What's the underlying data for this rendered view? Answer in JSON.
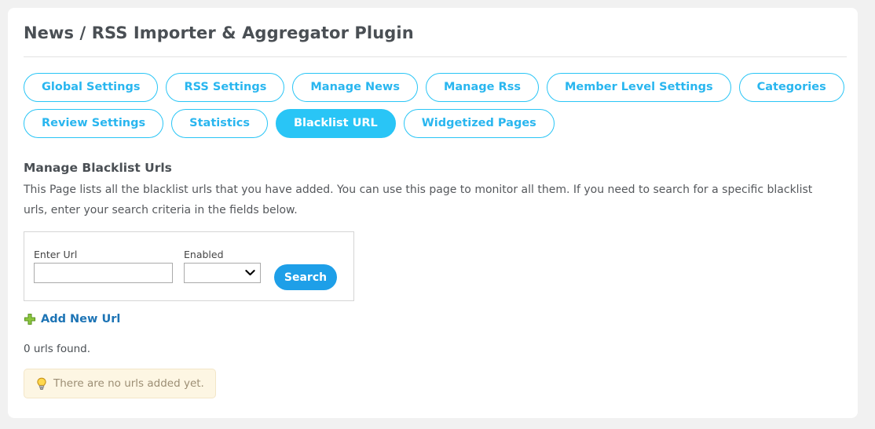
{
  "page": {
    "title": "News / RSS Importer & Aggregator Plugin"
  },
  "tabs": {
    "row1": [
      {
        "label": "Global Settings",
        "active": false
      },
      {
        "label": "RSS Settings",
        "active": false
      },
      {
        "label": "Manage News",
        "active": false
      },
      {
        "label": "Manage Rss",
        "active": false
      },
      {
        "label": "Member Level Settings",
        "active": false
      },
      {
        "label": "Categories",
        "active": false
      }
    ],
    "row2": [
      {
        "label": "Review Settings",
        "active": false
      },
      {
        "label": "Statistics",
        "active": false
      },
      {
        "label": "Blacklist URL",
        "active": true
      },
      {
        "label": "Widgetized Pages",
        "active": false
      }
    ]
  },
  "section": {
    "heading": "Manage Blacklist Urls",
    "description": "This Page lists all the blacklist urls that you have added. You can use this page to monitor all them. If you need to search for a specific blacklist urls, enter your search criteria in the fields below."
  },
  "search_form": {
    "url_label": "Enter Url",
    "url_value": "",
    "url_placeholder": "",
    "enabled_label": "Enabled",
    "enabled_value": "",
    "enabled_options": [
      ""
    ],
    "search_button": "Search"
  },
  "actions": {
    "add_new_label": "Add New Url",
    "add_new_icon": "plus-icon"
  },
  "results": {
    "count_text": "0 urls found.",
    "notice_text": "There are no urls added yet.",
    "notice_icon": "lightbulb-icon"
  },
  "colors": {
    "accent": "#29c5f6",
    "button": "#1e9fe8",
    "link": "#1d74b5",
    "notice_bg": "#fdf6e3",
    "notice_border": "#f3e6c8",
    "notice_text": "#9c8e74",
    "page_bg": "#f1f1f1"
  }
}
